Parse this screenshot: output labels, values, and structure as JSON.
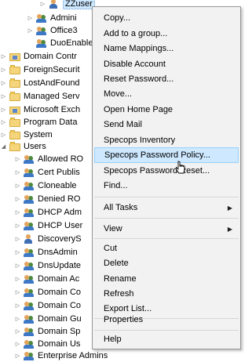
{
  "tree": {
    "rows": [
      {
        "label": "ZZuser",
        "icon": "user-icon",
        "expander": "right"
      },
      {
        "label": "Admini",
        "icon": "group-icon",
        "expander": "right"
      },
      {
        "label": "Office3",
        "icon": "group-icon",
        "expander": "right"
      },
      {
        "label": "DuoEnable",
        "icon": "group-icon",
        "expander": ""
      },
      {
        "label": "Domain Contr",
        "icon": "ou-icon",
        "expander": "right"
      },
      {
        "label": "ForeignSecurit",
        "icon": "folder-icon",
        "expander": "right"
      },
      {
        "label": "LostAndFound",
        "icon": "folder-icon",
        "expander": "right"
      },
      {
        "label": "Managed Serv",
        "icon": "folder-icon",
        "expander": "right"
      },
      {
        "label": "Microsoft Exch",
        "icon": "ou-icon",
        "expander": "right"
      },
      {
        "label": "Program Data",
        "icon": "folder-icon",
        "expander": "right"
      },
      {
        "label": "System",
        "icon": "folder-icon",
        "expander": "right"
      },
      {
        "label": "Users",
        "icon": "folder-icon",
        "expander": "down"
      },
      {
        "label": "Allowed RO",
        "icon": "group-icon",
        "expander": "right"
      },
      {
        "label": "Cert Publis",
        "icon": "group-icon",
        "expander": "right"
      },
      {
        "label": "Cloneable",
        "icon": "group-icon",
        "expander": "right"
      },
      {
        "label": "Denied RO",
        "icon": "group-icon",
        "expander": "right"
      },
      {
        "label": "DHCP Adm",
        "icon": "group-icon",
        "expander": "right"
      },
      {
        "label": "DHCP User",
        "icon": "group-icon",
        "expander": "right"
      },
      {
        "label": "DiscoveryS",
        "icon": "user-icon",
        "expander": "right"
      },
      {
        "label": "DnsAdmin",
        "icon": "group-icon",
        "expander": "right"
      },
      {
        "label": "DnsUpdate",
        "icon": "group-icon",
        "expander": "right"
      },
      {
        "label": "Domain Ac",
        "icon": "group-icon",
        "expander": "right"
      },
      {
        "label": "Domain Co",
        "icon": "group-icon",
        "expander": "right"
      },
      {
        "label": "Domain Co",
        "icon": "group-icon",
        "expander": "right"
      },
      {
        "label": "Domain Gu",
        "icon": "group-icon",
        "expander": "right"
      },
      {
        "label": "Domain Sp",
        "icon": "group-icon",
        "expander": "right"
      },
      {
        "label": "Domain Us",
        "icon": "group-icon",
        "expander": "right"
      },
      {
        "label": "Enterprise Admins",
        "icon": "group-icon",
        "expander": "right"
      }
    ]
  },
  "menu": {
    "items": [
      {
        "label": "Copy...",
        "type": "item"
      },
      {
        "label": "Add to a group...",
        "type": "item"
      },
      {
        "label": "Name Mappings...",
        "type": "item"
      },
      {
        "label": "Disable Account",
        "type": "item"
      },
      {
        "label": "Reset Password...",
        "type": "item"
      },
      {
        "label": "Move...",
        "type": "item"
      },
      {
        "label": "Open Home Page",
        "type": "item"
      },
      {
        "label": "Send Mail",
        "type": "item"
      },
      {
        "label": "Specops Inventory",
        "type": "item"
      },
      {
        "label": "Specops Password Policy...",
        "type": "item",
        "highlighted": true
      },
      {
        "label": "Specops Password Reset...",
        "type": "item"
      },
      {
        "label": "Find...",
        "type": "item"
      },
      {
        "type": "separator"
      },
      {
        "label": "All Tasks",
        "type": "submenu"
      },
      {
        "type": "separator"
      },
      {
        "label": "View",
        "type": "submenu"
      },
      {
        "type": "separator"
      },
      {
        "label": "Cut",
        "type": "item"
      },
      {
        "label": "Delete",
        "type": "item"
      },
      {
        "label": "Rename",
        "type": "item"
      },
      {
        "label": "Refresh",
        "type": "item"
      },
      {
        "label": "Export List...",
        "type": "item"
      },
      {
        "type": "separator"
      },
      {
        "label": "Properties",
        "type": "item"
      },
      {
        "type": "separator"
      },
      {
        "label": "Help",
        "type": "item"
      }
    ],
    "highlight_color": "#cde8ff"
  }
}
